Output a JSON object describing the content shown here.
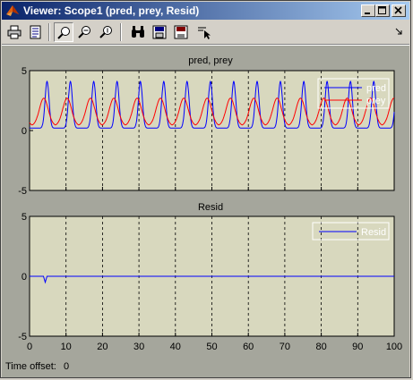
{
  "window": {
    "title": "Viewer: Scope1 (pred, prey, Resid)"
  },
  "toolbar": {
    "tools": [
      "print-icon",
      "parameters-icon",
      "zoom-icon",
      "zoom-x-icon",
      "zoom-y-icon",
      "autoscale-icon",
      "save-axes-icon",
      "restore-axes-icon",
      "select-signals-icon"
    ],
    "dock_icon": "dock-arrow-icon"
  },
  "footer": {
    "time_offset_label": "Time offset:",
    "time_offset_value": "0"
  },
  "colors": {
    "axes_bg": "#d8d8be",
    "figure_bg": "#a5a69c",
    "pred": "#0000ff",
    "prey": "#ff0000",
    "resid": "#0000ff",
    "title_bar": "#0a246a"
  },
  "chart_data": [
    {
      "type": "line",
      "title": "pred, prey",
      "xlim": [
        0,
        100
      ],
      "ylim": [
        -5,
        5
      ],
      "x_ticks": [
        0,
        10,
        20,
        30,
        40,
        50,
        60,
        70,
        80,
        90,
        100
      ],
      "y_ticks": [
        -5,
        0,
        5
      ],
      "x_tick_labels": [
        "0",
        "10",
        "20",
        "30",
        "40",
        "50",
        "60",
        "70",
        "80",
        "90",
        "100"
      ],
      "y_tick_labels": [
        "-5",
        "0",
        "5"
      ],
      "grid": "vertical-dashed",
      "legend_position": "top-right",
      "series": [
        {
          "name": "pred",
          "color": "#0000ff",
          "baseline": 0.2,
          "peak": 4.1,
          "period": 6.4,
          "peak_offset": 4.8,
          "width": 0.55
        },
        {
          "name": "prey",
          "color": "#ff0000",
          "baseline": 0.4,
          "peak": 2.7,
          "period": 6.4,
          "peak_offset": 3.9,
          "width": 1.2
        }
      ]
    },
    {
      "type": "line",
      "title": "Resid",
      "xlim": [
        0,
        100
      ],
      "ylim": [
        -5,
        5
      ],
      "x_ticks": [
        0,
        10,
        20,
        30,
        40,
        50,
        60,
        70,
        80,
        90,
        100
      ],
      "y_ticks": [
        -5,
        0,
        5
      ],
      "x_tick_labels": [
        "0",
        "10",
        "20",
        "30",
        "40",
        "50",
        "60",
        "70",
        "80",
        "90",
        "100"
      ],
      "y_tick_labels": [
        "-5",
        "0",
        "5"
      ],
      "grid": "vertical-dashed",
      "legend_position": "top-right",
      "series": [
        {
          "name": "Resid",
          "color": "#0000ff",
          "x": [
            0,
            3.8,
            4.3,
            4.8,
            100
          ],
          "y": [
            0,
            0,
            -0.5,
            0,
            0
          ]
        }
      ]
    }
  ]
}
